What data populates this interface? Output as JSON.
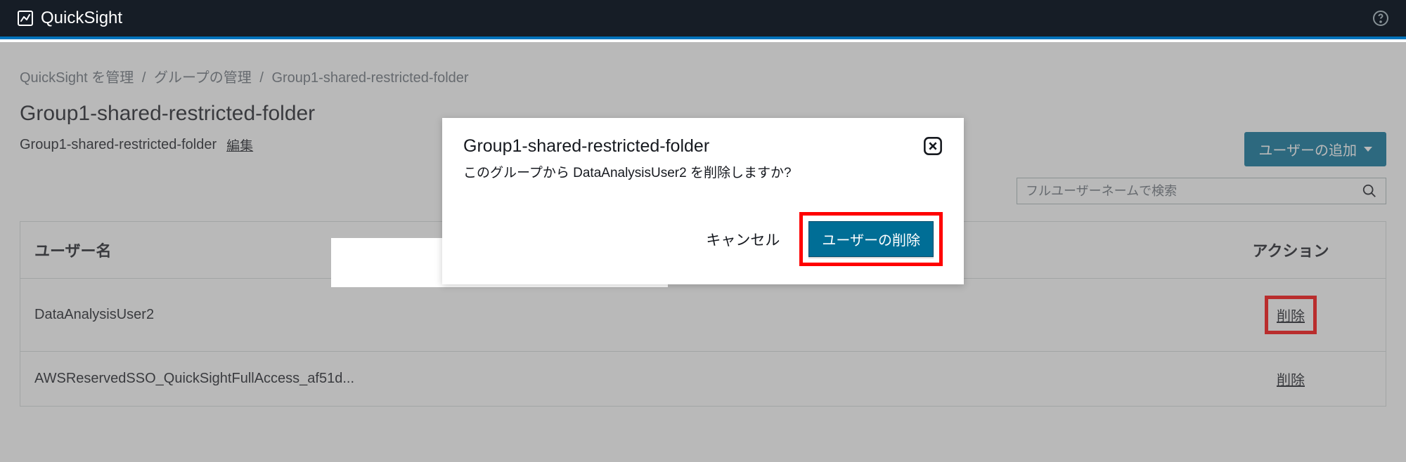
{
  "header": {
    "product": "QuickSight"
  },
  "breadcrumb": {
    "items": [
      "QuickSight を管理",
      "グループの管理",
      "Group1-shared-restricted-folder"
    ],
    "separator": "/"
  },
  "page": {
    "title": "Group1-shared-restricted-folder",
    "subtitle": "Group1-shared-restricted-folder",
    "edit_label": "編集"
  },
  "toolbar": {
    "add_user_label": "ユーザーの追加"
  },
  "search": {
    "placeholder": "フルユーザーネームで検索"
  },
  "table": {
    "headers": {
      "username": "ユーザー名",
      "action": "アクション"
    },
    "rows": [
      {
        "username": "DataAnalysisUser2",
        "action": "削除",
        "highlighted": true
      },
      {
        "username": "AWSReservedSSO_QuickSightFullAccess_af51d...",
        "action": "削除",
        "highlighted": false
      }
    ]
  },
  "modal": {
    "title": "Group1-shared-restricted-folder",
    "message": "このグループから DataAnalysisUser2 を削除しますか?",
    "cancel": "キャンセル",
    "confirm": "ユーザーの削除"
  }
}
